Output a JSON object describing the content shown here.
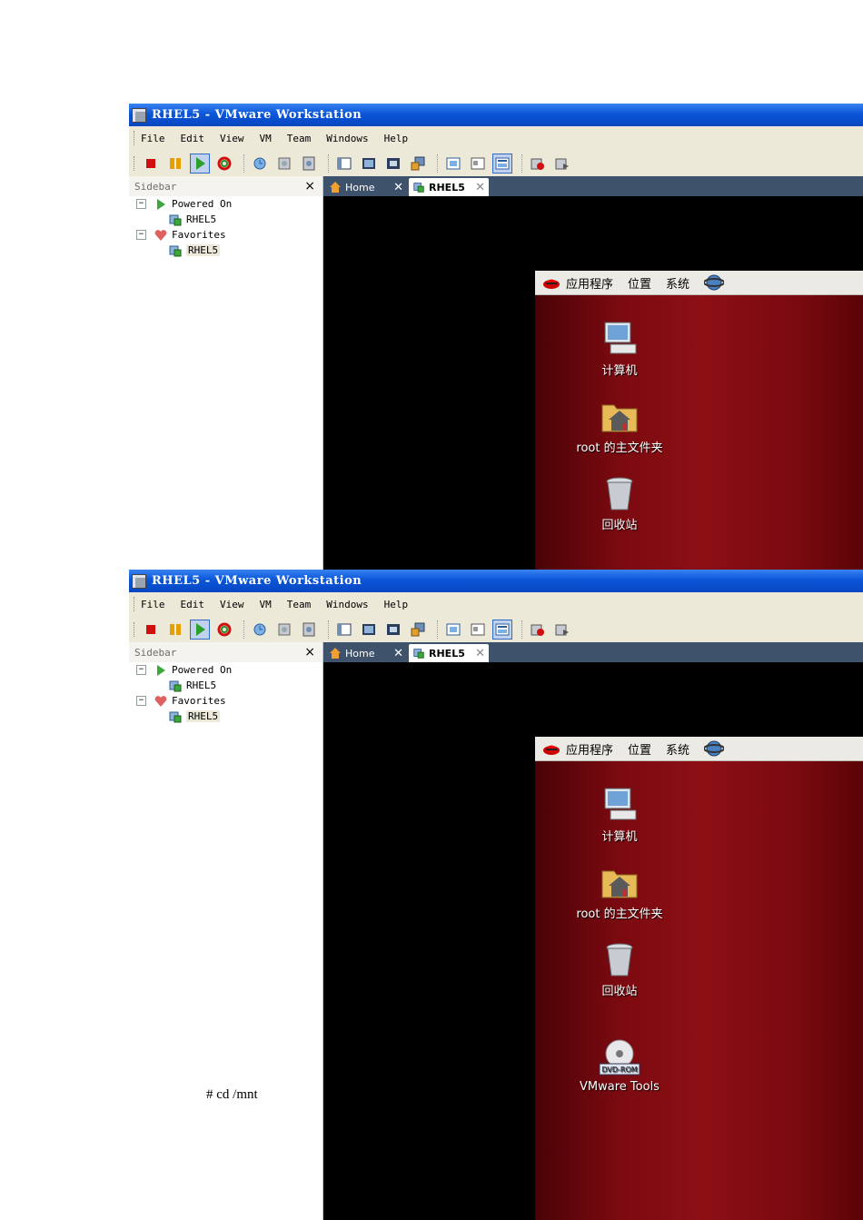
{
  "window": {
    "title": "RHEL5 - VMware Workstation"
  },
  "menubar": [
    "File",
    "Edit",
    "View",
    "VM",
    "Team",
    "Windows",
    "Help"
  ],
  "sidebar": {
    "header": "Sidebar",
    "close": "×",
    "groups": [
      {
        "label": "Powered On",
        "icon": "play-icon",
        "items": [
          "RHEL5"
        ]
      },
      {
        "label": "Favorites",
        "icon": "heart-icon",
        "items": [
          "RHEL5"
        ]
      }
    ]
  },
  "tabs": [
    {
      "label": "Home",
      "icon": "home-icon",
      "close": "✕"
    },
    {
      "label": "RHEL5",
      "icon": "vm-icon",
      "close": "✕",
      "active": true
    }
  ],
  "guest": {
    "panel_menus": [
      "应用程序",
      "位置",
      "系统"
    ],
    "desktop_icons_first": [
      "计算机",
      "root 的主文件夹",
      "回收站"
    ],
    "desktop_icons_second": [
      "计算机",
      "root 的主文件夹",
      "回收站",
      "VMware Tools"
    ],
    "dvd_label": "DVD-ROM"
  },
  "caption": "# cd /mnt",
  "colors": {
    "titlebar": "#0a56d8",
    "tabstrip": "#3e526c",
    "desktop": "#7a0a10"
  }
}
